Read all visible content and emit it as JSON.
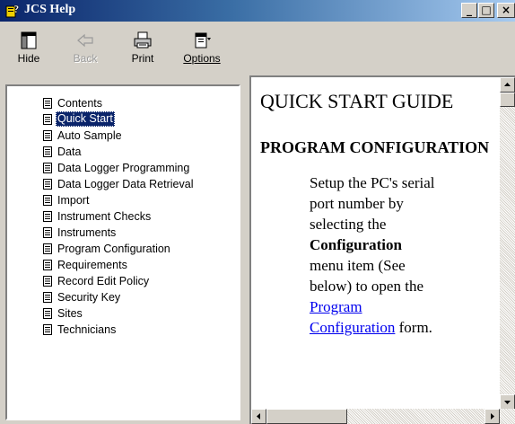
{
  "window": {
    "title": "JCS Help",
    "icon": "help-book-icon",
    "buttons": {
      "minimize": "_",
      "maximize": "□",
      "close": "×"
    }
  },
  "toolbar": {
    "hide": "Hide",
    "back": "Back",
    "print": "Print",
    "options": "Options"
  },
  "tree": {
    "items": [
      "Contents",
      "Quick Start",
      "Auto Sample",
      "Data",
      "Data Logger Programming",
      "Data Logger Data Retrieval",
      "Import",
      "Instrument Checks",
      "Instruments",
      "Program Configuration",
      "Requirements",
      "Record Edit Policy",
      "Security Key",
      "Sites",
      "Technicians"
    ],
    "selected": "Quick Start"
  },
  "content": {
    "heading": "QUICK START GUIDE",
    "subheading": "PROGRAM CONFIGURATION",
    "para_part1": "Setup the PC's serial port number by selecting the ",
    "para_bold": "Configuration",
    "para_part2": " menu item (See below) to open the ",
    "para_link": "Program Configuration",
    "para_part3": " form."
  },
  "colors": {
    "titlebar_start": "#0a246a",
    "titlebar_end": "#a6caf0",
    "selection": "#0a246a",
    "link": "#0000ee",
    "face": "#d4d0c8"
  }
}
